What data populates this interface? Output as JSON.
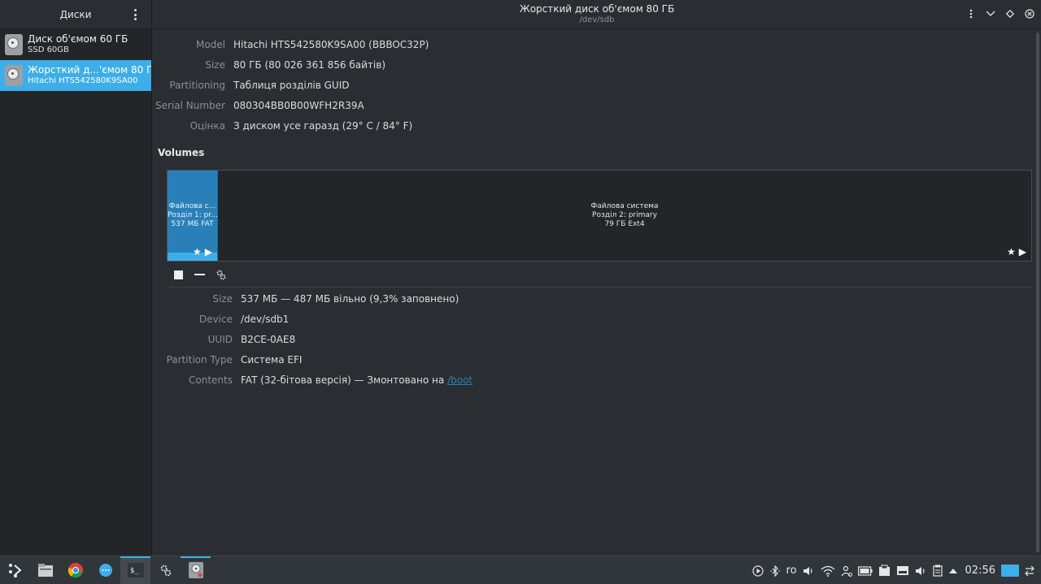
{
  "sidebar": {
    "title": "Диски",
    "items": [
      {
        "name": "Диск об'ємом 60 ГБ",
        "sub": "SSD 60GB",
        "selected": false
      },
      {
        "name": "Жорсткий д...'ємом 80 ГБ",
        "sub": "Hitachi HTS542580K9SA00",
        "selected": true
      }
    ]
  },
  "header": {
    "title": "Жорсткий диск об'ємом 80 ГБ",
    "subtitle": "/dev/sdb"
  },
  "drive": {
    "model_label": "Model",
    "model": "Hitachi HTS542580K9SA00 (BBBOC32P)",
    "size_label": "Size",
    "size": "80 ГБ (80 026 361 856 байтів)",
    "partitioning_label": "Partitioning",
    "partitioning": "Таблиця розділів GUID",
    "serial_label": "Serial Number",
    "serial": "080304BB0B00WFH2R39A",
    "assessment_label": "Оцінка",
    "assessment": "З диском усе гаразд (29° C / 84° F)"
  },
  "volumes": {
    "title": "Volumes",
    "partitions": [
      {
        "line1": "Файлова с...",
        "line2": "Розділ 1: pr...",
        "line3": "537 МБ FAT",
        "fill_fraction": 0.093,
        "selected": true
      },
      {
        "line1": "Файлова система",
        "line2": "Розділ 2: primary",
        "line3": "79 ГБ Ext4",
        "selected": false
      }
    ]
  },
  "volume_details": {
    "size_label": "Size",
    "size": "537 МБ — 487 МБ вільно (9,3% заповнено)",
    "device_label": "Device",
    "device": "/dev/sdb1",
    "uuid_label": "UUID",
    "uuid": "B2CE-0AE8",
    "ptype_label": "Partition Type",
    "ptype": "Система EFI",
    "contents_label": "Contents",
    "contents_prefix": "FAT (32-бітова версія) — Змонтовано на ",
    "mount_link": "/boot"
  },
  "taskbar": {
    "keyboard_layout": "ro",
    "clock": "02:56"
  },
  "colors": {
    "accent": "#3daee9",
    "partition_blue": "#2980b9",
    "background": "#2a2e32",
    "sidebar": "#232629"
  }
}
